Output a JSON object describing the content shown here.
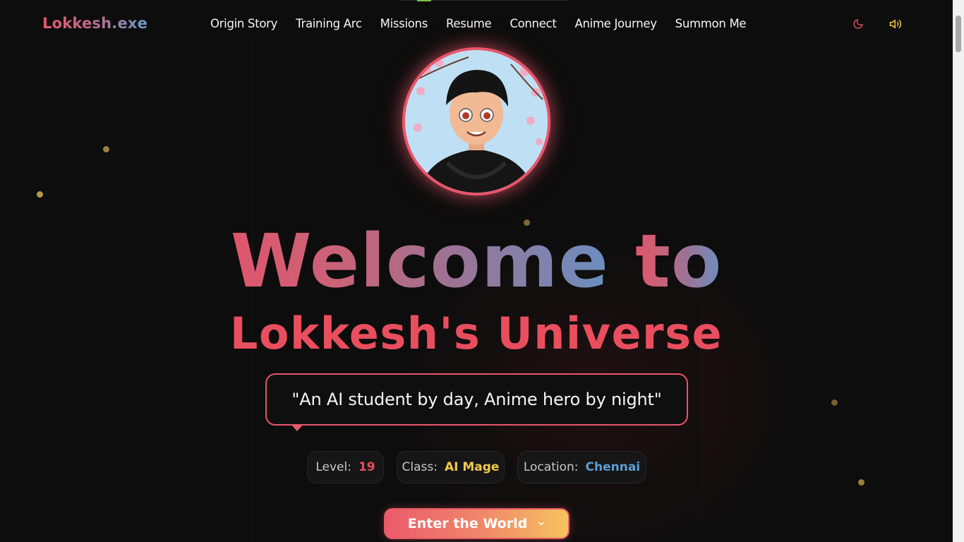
{
  "nav": {
    "logo": "Lokkesh.exe",
    "links": [
      "Origin Story",
      "Training Arc",
      "Missions",
      "Resume",
      "Connect",
      "Anime Journey",
      "Summon Me"
    ],
    "icons": [
      "moon-icon",
      "speaker-icon"
    ]
  },
  "hero": {
    "avatar_alt": "Anime-style avatar portrait",
    "title_line1_word1": "Welcome",
    "title_line1_word2": "to",
    "title_line2": "Lokkesh's Universe",
    "tagline": "\"An AI student by day, Anime hero by night\"",
    "stats": [
      {
        "label": "Level:",
        "value": "19"
      },
      {
        "label": "Class:",
        "value": "AI Mage"
      },
      {
        "label": "Location:",
        "value": "Chennai"
      }
    ],
    "cta_label": "Enter the World"
  },
  "colors": {
    "background": "#0d0d0d",
    "accent_red": "#e94e5e",
    "accent_gold": "#f2c94c",
    "accent_blue": "#5b9fd6"
  }
}
